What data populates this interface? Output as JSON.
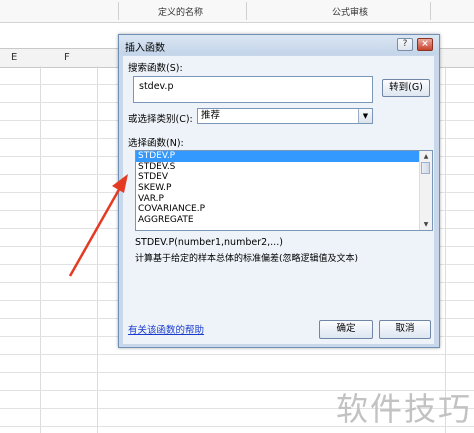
{
  "ribbon": {
    "labels": [
      "定义的名称",
      "公式审核"
    ]
  },
  "sheet": {
    "columns": [
      "E",
      "F"
    ]
  },
  "dialog": {
    "title": "插入函数",
    "help_icon": "?",
    "close_icon": "×",
    "search_label": "搜索函数(S):",
    "search_value": "stdev.p",
    "goto_button": "转到(G)",
    "category_label": "或选择类别(C):",
    "category_value": "推荐",
    "function_list_label": "选择函数(N):",
    "functions": [
      "STDEV.P",
      "STDEV.S",
      "STDEV",
      "SKEW.P",
      "VAR.P",
      "COVARIANCE.P",
      "AGGREGATE"
    ],
    "selected_index": 0,
    "signature": "STDEV.P(number1,number2,...)",
    "description": "计算基于给定的样本总体的标准偏差(忽略逻辑值及文本)",
    "help_link": "有关该函数的帮助",
    "ok_button": "确定",
    "cancel_button": "取消"
  },
  "watermark": "软件技巧",
  "colors": {
    "annotation_arrow": "#e53a22",
    "selection": "#3399ff",
    "dialog_border": "#6f8fb5",
    "link": "#1a3ccd"
  }
}
